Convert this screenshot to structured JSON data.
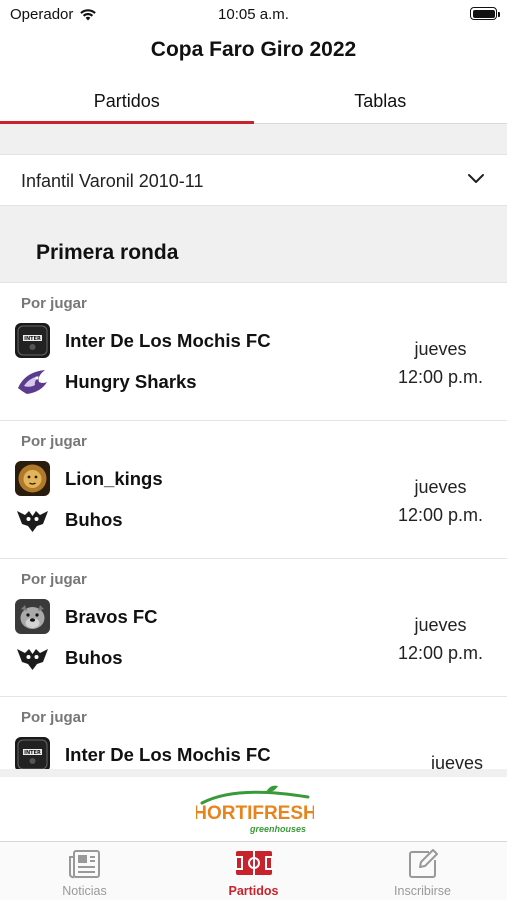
{
  "status_bar": {
    "carrier": "Operador",
    "time": "10:05 a.m."
  },
  "title": "Copa Faro Giro 2022",
  "tabs": [
    {
      "label": "Partidos",
      "active": true
    },
    {
      "label": "Tablas",
      "active": false
    }
  ],
  "category_select": {
    "value": "Infantil Varonil 2010-11"
  },
  "round": {
    "title": "Primera ronda"
  },
  "matches": [
    {
      "status": "Por jugar",
      "home": {
        "name": "Inter De Los Mochis FC",
        "logo": "inter-logo-icon"
      },
      "away": {
        "name": "Hungry Sharks",
        "logo": "shark-logo-icon"
      },
      "day": "jueves",
      "time": "12:00 p.m."
    },
    {
      "status": "Por jugar",
      "home": {
        "name": "Lion_kings",
        "logo": "lion-logo-icon"
      },
      "away": {
        "name": "Buhos",
        "logo": "owl-logo-icon"
      },
      "day": "jueves",
      "time": "12:00 p.m."
    },
    {
      "status": "Por jugar",
      "home": {
        "name": "Bravos FC",
        "logo": "bulldog-logo-icon"
      },
      "away": {
        "name": "Buhos",
        "logo": "owl-logo-icon"
      },
      "day": "jueves",
      "time": "12:00 p.m."
    },
    {
      "status": "Por jugar",
      "home": {
        "name": "Inter De Los Mochis FC",
        "logo": "inter-logo-icon"
      },
      "away": {
        "name": "",
        "logo": ""
      },
      "day": "jueves",
      "time": ""
    }
  ],
  "sponsor": {
    "name": "HORTIFRESH",
    "tagline": "greenhouses"
  },
  "bottom_nav": [
    {
      "label": "Noticias",
      "icon": "newspaper-icon",
      "active": false
    },
    {
      "label": "Partidos",
      "icon": "soccer-field-icon",
      "active": true
    },
    {
      "label": "Inscribirse",
      "icon": "edit-icon",
      "active": false
    }
  ],
  "colors": {
    "accent": "#c8232c",
    "section_bg": "#f0f0f0",
    "muted_text": "#777777",
    "sponsor_green": "#3a9a3a",
    "sponsor_orange": "#e8841c"
  }
}
